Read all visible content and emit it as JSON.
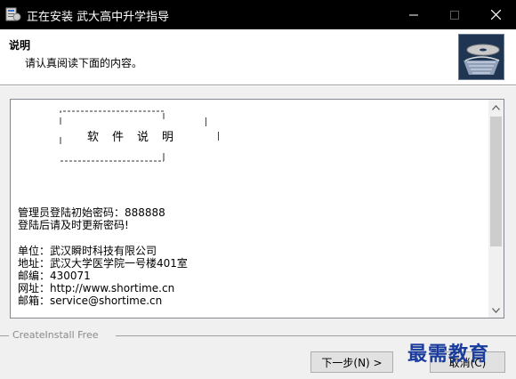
{
  "window": {
    "title": "正在安装 武大高中升学指导",
    "titlebar_color": "#000000"
  },
  "header": {
    "title": "说明",
    "subtitle": "请认真阅读下面的内容。"
  },
  "content": {
    "banner": [
      "软",
      "件",
      "说",
      "明"
    ],
    "lines": [
      "管理员登陆初始密码：888888",
      "登陆后请及时更新密码!",
      "单位：武汉瞬时科技有限公司",
      "地址：武汉大学医学院一号楼401室",
      "邮编：430071",
      "网址：http://www.shortime.cn",
      "邮箱：service@shortime.cn"
    ]
  },
  "footer": {
    "brand": "CreateInstall Free",
    "next_label": "下一步(N) >",
    "cancel_label": "取消(C)"
  },
  "watermark": "最需教育",
  "icons": {
    "app": "installer-icon",
    "minimize": "minimize-icon",
    "maximize": "maximize-icon",
    "close": "close-icon",
    "logo": "cd-box-logo-icon",
    "scroll_up": "chevron-up-icon",
    "scroll_down": "chevron-down-icon"
  }
}
